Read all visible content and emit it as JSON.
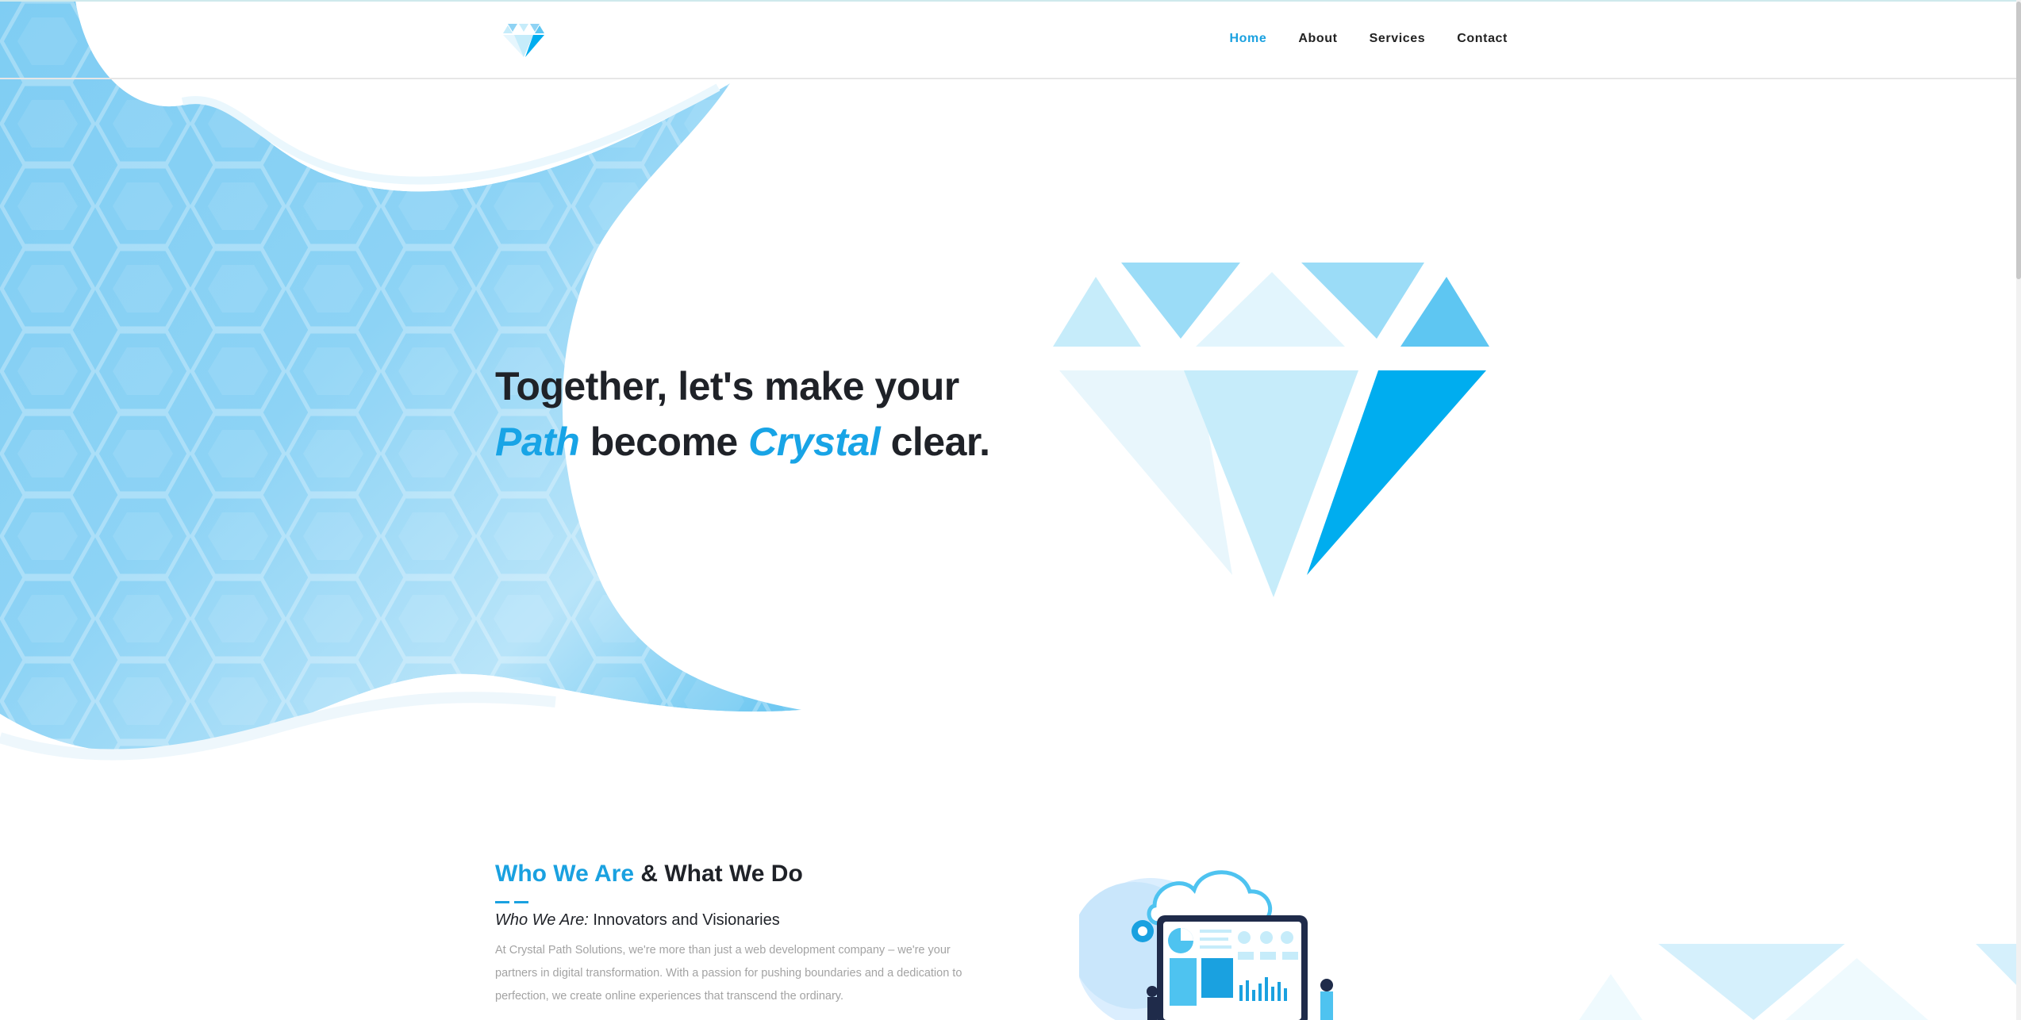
{
  "brand": {
    "logo_icon": "diamond-icon",
    "accent_color": "#1aa1e0"
  },
  "nav": {
    "items": [
      {
        "label": "Home",
        "active": true
      },
      {
        "label": "About",
        "active": false
      },
      {
        "label": "Services",
        "active": false
      },
      {
        "label": "Contact",
        "active": false
      }
    ]
  },
  "hero": {
    "line1": "Together, let's make your",
    "word_path": "Path",
    "word_become": "become",
    "word_crystal": "Crystal",
    "word_clear": "clear."
  },
  "about": {
    "title_blue": "Who We Are",
    "title_rest": "& What We Do",
    "subtitle_label": "Who We Are:",
    "subtitle_text": "Innovators and Visionaries",
    "body": "At Crystal Path Solutions, we're more than just a web development company – we're your partners in digital transformation. With a passion for pushing boundaries and a dedication to perfection, we create online experiences that transcend the ordinary."
  },
  "colors": {
    "light_blue": "#8fd3f4",
    "mid_blue": "#5ec6f2",
    "deep_blue": "#00adef",
    "pale_blue": "#c6ecfa"
  }
}
